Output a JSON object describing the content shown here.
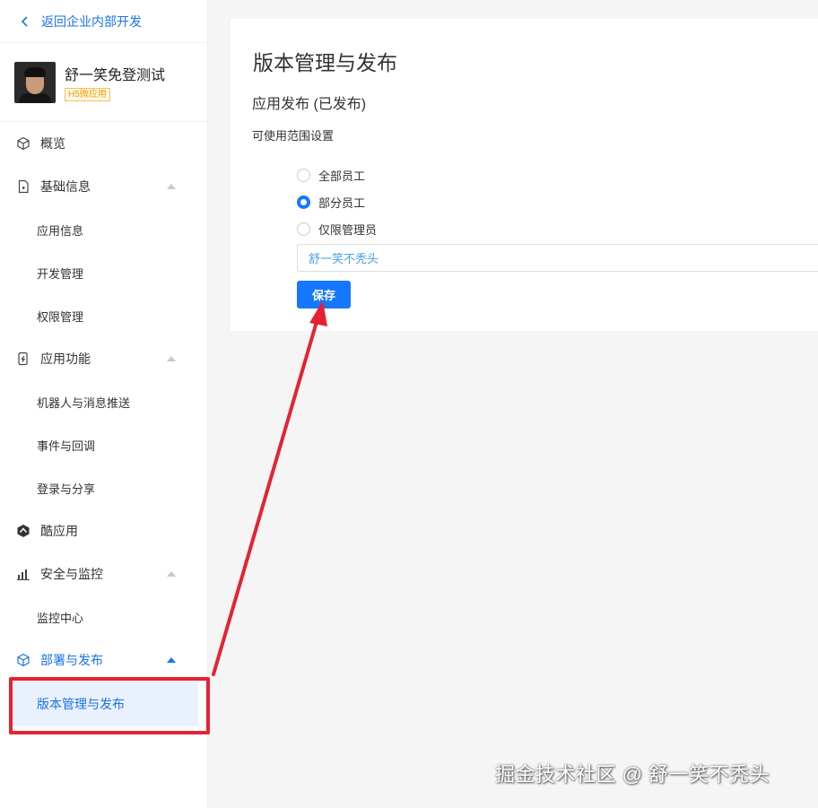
{
  "sidebar": {
    "back_label": "返回企业内部开发",
    "app_name": "舒一笑免登测试",
    "app_badge": "H5微应用",
    "items": [
      {
        "label": "概览",
        "icon": "cube-outline-icon"
      },
      {
        "label": "基础信息",
        "icon": "document-icon"
      },
      {
        "label": "应用信息"
      },
      {
        "label": "开发管理"
      },
      {
        "label": "权限管理"
      },
      {
        "label": "应用功能",
        "icon": "phone-bolt-icon"
      },
      {
        "label": "机器人与消息推送"
      },
      {
        "label": "事件与回调"
      },
      {
        "label": "登录与分享"
      },
      {
        "label": "酷应用",
        "icon": "cool-app-icon"
      },
      {
        "label": "安全与监控",
        "icon": "bar-chart-icon"
      },
      {
        "label": "监控中心"
      },
      {
        "label": "部署与发布",
        "icon": "deploy-cube-icon"
      },
      {
        "label": "版本管理与发布"
      }
    ]
  },
  "main": {
    "title": "版本管理与发布",
    "section_title": "应用发布 (已发布)",
    "scope_label": "可使用范围设置",
    "options": [
      {
        "label": "全部员工",
        "checked": false
      },
      {
        "label": "部分员工",
        "checked": true
      },
      {
        "label": "仅限管理员",
        "checked": false
      }
    ],
    "member_value": "舒一笑不秃头",
    "save_label": "保存"
  },
  "colors": {
    "accent": "#1677ff",
    "highlight": "#e52233"
  },
  "watermark": "掘金技术社区 @ 舒一笑不秃头"
}
